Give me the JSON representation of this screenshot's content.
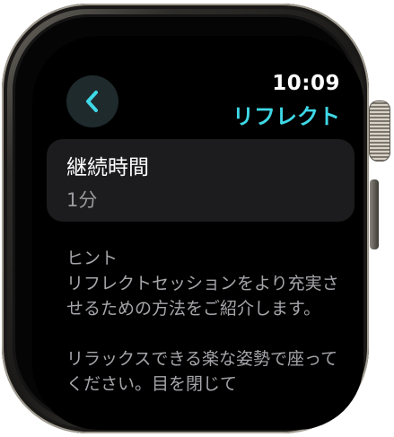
{
  "status": {
    "time": "10:09"
  },
  "header": {
    "title": "リフレクト",
    "back_icon": "chevron-left-icon",
    "accent_color": "#3fd8e6"
  },
  "duration": {
    "label": "継続時間",
    "value": "1分"
  },
  "hint": {
    "heading": "ヒント",
    "body": "リフレクトセッションをより充実させるための方法をご紹介します。",
    "body_2": "リラックスできる楽な姿勢で座ってください。目を閉じて"
  }
}
